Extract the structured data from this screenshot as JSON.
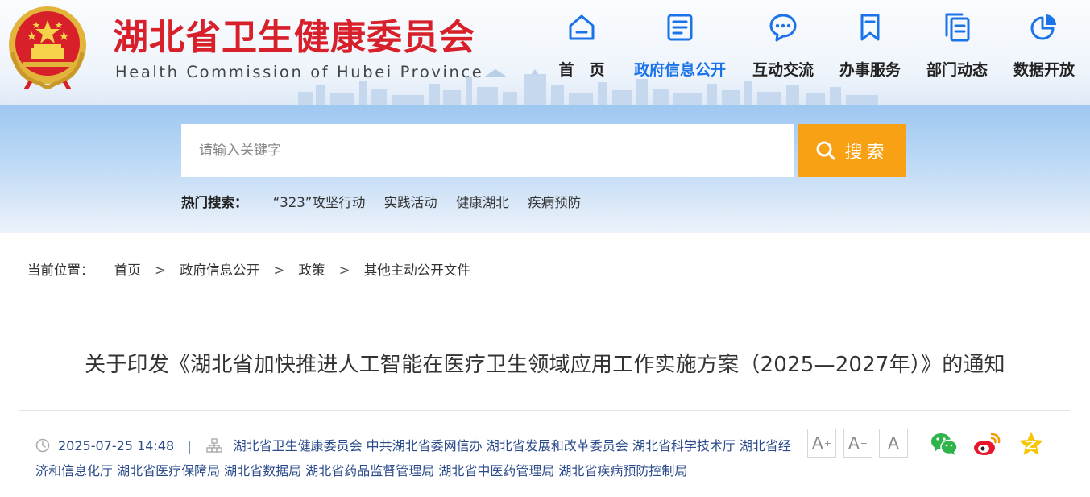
{
  "header": {
    "title": "湖北省卫生健康委员会",
    "subtitle": "Health Commission of Hubei Province"
  },
  "nav": {
    "items": [
      {
        "label": "首　页",
        "icon": "home-icon"
      },
      {
        "label": "政府信息公开",
        "icon": "document-list-icon"
      },
      {
        "label": "互动交流",
        "icon": "chat-bubble-icon"
      },
      {
        "label": "办事服务",
        "icon": "bookmark-icon"
      },
      {
        "label": "部门动态",
        "icon": "copy-document-icon"
      },
      {
        "label": "数据开放",
        "icon": "pie-chart-icon"
      }
    ],
    "active_index": 1,
    "active_color": "#1a73e8"
  },
  "search": {
    "placeholder": "请输入关键字",
    "button_label": "搜索",
    "button_color": "#f8a115",
    "hot_label": "热门搜索：",
    "hot_items": [
      "“323”攻坚行动",
      "实践活动",
      "健康湖北",
      "疾病预防"
    ]
  },
  "breadcrumb": {
    "prefix": "当前位置：",
    "items": [
      "首页",
      "政府信息公开",
      "政策",
      "其他主动公开文件"
    ],
    "separator": ">"
  },
  "article": {
    "title": "关于印发《湖北省加快推进人工智能在医疗卫生领域应用工作实施方案（2025—2027年）》的通知",
    "date": "2025-07-25 14:48",
    "meta_separator": "|",
    "publishers": "湖北省卫生健康委员会 中共湖北省委网信办 湖北省发展和改革委员会 湖北省科学技术厅 湖北省经济和信息化厅 湖北省医疗保障局 湖北省数据局 湖北省药品监督管理局 湖北省中医药管理局 湖北省疾病预防控制局"
  },
  "font_size": {
    "larger": "A",
    "normal": "A",
    "reset": "A",
    "plus": "+",
    "minus": "−"
  },
  "share": {
    "items": [
      "wechat-icon",
      "weibo-icon",
      "qzone-icon"
    ]
  },
  "colors": {
    "brand_red": "#d7202a",
    "link_blue": "#2a4a8a",
    "accent_orange": "#f8a115"
  }
}
